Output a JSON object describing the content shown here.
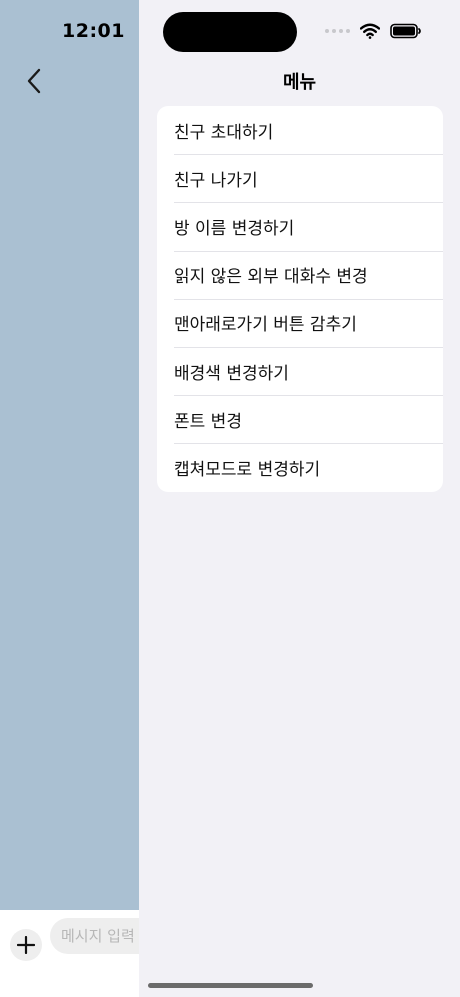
{
  "status_bar": {
    "time": "12:01"
  },
  "chat": {
    "input_placeholder": "메시지 입력"
  },
  "menu": {
    "title": "메뉴",
    "items": [
      {
        "label": "친구 초대하기"
      },
      {
        "label": "친구 나가기"
      },
      {
        "label": "방 이름 변경하기"
      },
      {
        "label": "읽지 않은 외부 대화수 변경"
      },
      {
        "label": "맨아래로가기 버튼 감추기"
      },
      {
        "label": "배경색 변경하기"
      },
      {
        "label": "폰트 변경"
      },
      {
        "label": "캡쳐모드로 변경하기"
      }
    ]
  },
  "colors": {
    "chat_background": "#aac0d2",
    "menu_background": "#f2f1f6",
    "card_background": "#ffffff"
  },
  "icons": {
    "back": "chevron-left-icon",
    "add": "plus-icon",
    "wifi": "wifi-icon",
    "battery": "battery-icon",
    "signal": "cellular-signal-icon"
  }
}
